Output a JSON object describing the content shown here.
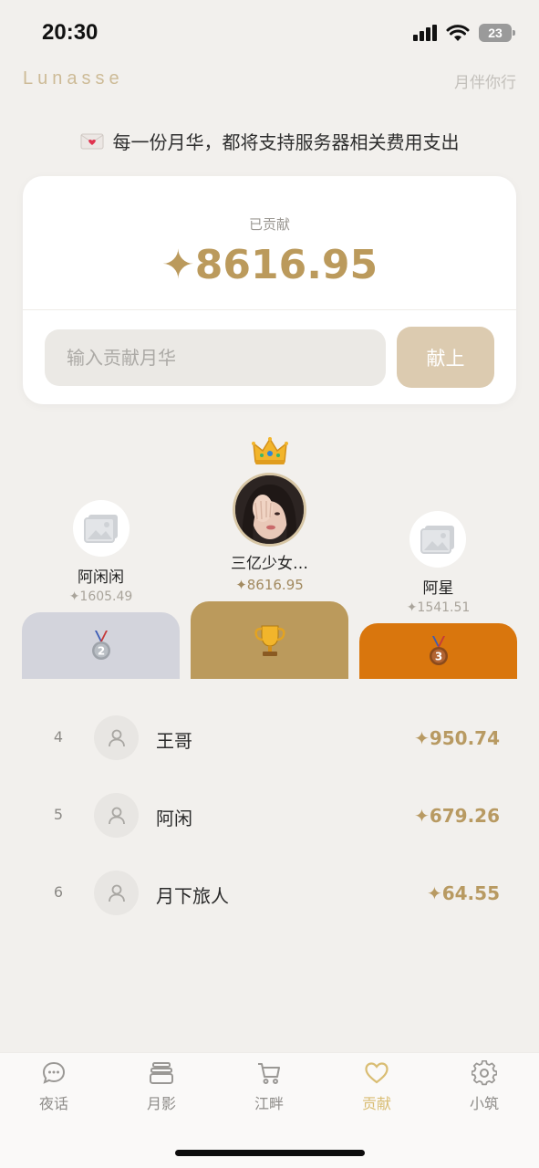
{
  "status_bar": {
    "time": "20:30",
    "battery": "23"
  },
  "header": {
    "brand": "Lunasse",
    "tagline": "月伴你行"
  },
  "notice": {
    "text": "每一份月华，都将支持服务器相关费用支出",
    "icon": "love-letter-icon"
  },
  "contribution_card": {
    "label": "已贡献",
    "total": "✦8616.95",
    "input_placeholder": "输入贡献月华",
    "submit_label": "献上"
  },
  "podium": {
    "first": {
      "name": "三亿少女…",
      "amount": "✦8616.95",
      "icon": "trophy-icon",
      "color": "#bb9a5c"
    },
    "second": {
      "name": "阿闲闲",
      "amount": "✦1605.49",
      "icon": "silver-medal-icon",
      "color": "#d3d4dc"
    },
    "third": {
      "name": "阿星",
      "amount": "✦1541.51",
      "icon": "bronze-medal-icon",
      "color": "#d9760d"
    }
  },
  "leaderboard": [
    {
      "rank": "4",
      "name": "王哥",
      "amount": "✦950.74"
    },
    {
      "rank": "5",
      "name": "阿闲",
      "amount": "✦679.26"
    },
    {
      "rank": "6",
      "name": "月下旅人",
      "amount": "✦64.55"
    }
  ],
  "tabs": [
    {
      "label": "夜话",
      "icon": "chat-bubble-icon",
      "active": false
    },
    {
      "label": "月影",
      "icon": "stack-icon",
      "active": false
    },
    {
      "label": "江畔",
      "icon": "cart-icon",
      "active": false
    },
    {
      "label": "贡献",
      "icon": "heart-icon",
      "active": true
    },
    {
      "label": "小筑",
      "icon": "gear-icon",
      "active": false
    }
  ],
  "colors": {
    "accent": "#d9bd73",
    "gold": "#bb9a5c",
    "background": "#f2f0ed"
  }
}
